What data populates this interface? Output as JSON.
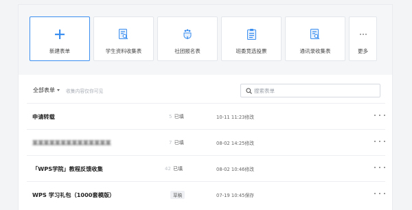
{
  "cards": [
    {
      "label": "新建表单",
      "icon": "plus-icon"
    },
    {
      "label": "学生资料收集表",
      "icon": "form-search-icon"
    },
    {
      "label": "社团报名表",
      "icon": "club-signup-icon"
    },
    {
      "label": "班委竞选投票",
      "icon": "clipboard-vote-icon"
    },
    {
      "label": "通讯录收集表",
      "icon": "form-search-icon"
    },
    {
      "label": "更多",
      "icon": "more-dots-icon"
    }
  ],
  "filter": {
    "all_label": "全部表单",
    "note": "收集内容仅你可见"
  },
  "search": {
    "placeholder": "搜索表单"
  },
  "forms": [
    {
      "title": "申请转载",
      "count_prefix": "5",
      "count_label": "已填",
      "time": "10-11 11:23修改",
      "blurred": false
    },
    {
      "title": "某某某某某某某某某某某某某某",
      "count_prefix": "7",
      "count_label": "已填",
      "time": "08-02 14:25修改",
      "blurred": true
    },
    {
      "title": "「WPS学院」教程反馈收集",
      "count_prefix": "42",
      "count_label": "已填",
      "time": "08-02 10:46修改",
      "blurred": false
    },
    {
      "title": "WPS 学习礼包（1000套模版）",
      "badge": "草稿",
      "time": "07-19 10:45保存",
      "blurred": false
    }
  ],
  "colors": {
    "accent": "#3a8ef0",
    "background": "#f3f4f6"
  }
}
